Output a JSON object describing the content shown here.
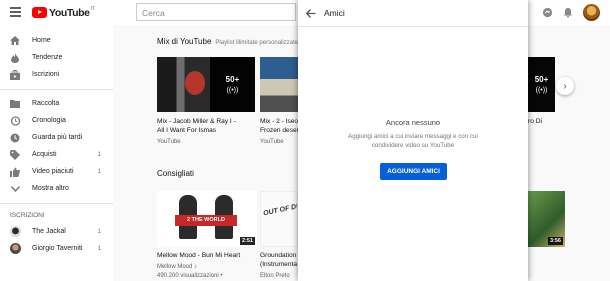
{
  "header": {
    "logo_text": "YouTube",
    "logo_country": "IT",
    "search_placeholder": "Cerca"
  },
  "sidebar": {
    "items": [
      {
        "label": "Home",
        "icon": "home-icon"
      },
      {
        "label": "Tendenze",
        "icon": "fire-icon"
      },
      {
        "label": "Iscrizioni",
        "icon": "subscriptions-icon"
      },
      {
        "label": "Raccolta",
        "icon": "folder-icon"
      },
      {
        "label": "Cronologia",
        "icon": "history-icon"
      },
      {
        "label": "Guarda più tardi",
        "icon": "clock-icon"
      },
      {
        "label": "Acquisti",
        "icon": "tag-icon",
        "count": "1"
      },
      {
        "label": "Video piaciuti",
        "icon": "thumb-up-icon",
        "count": "1"
      },
      {
        "label": "Mostra altro",
        "icon": "chevron-down-icon"
      }
    ],
    "subscriptions_heading": "ISCRIZIONI",
    "subscriptions": [
      {
        "label": "The Jackal",
        "count": "1"
      },
      {
        "label": "Giorgio Taverniti",
        "count": "1"
      }
    ]
  },
  "mixes": {
    "title": "Mix di YouTube",
    "subtitle": "Playlist illimitate personalizzate",
    "items": [
      {
        "title_line1": "Mix - Jacob Miller & Ray I -",
        "title_line2": "All I Want For Ismas",
        "channel": "YouTube",
        "count": "50+",
        "icon": "radio-icon"
      },
      {
        "title_line1": "Mix - 2 - Iseo",
        "title_line2": "Frozen deser",
        "channel": "YouTube",
        "count": "50+",
        "icon": "radio-icon"
      },
      {
        "title_line1": "ro Di",
        "title_line2": "",
        "channel": "",
        "count": "50+",
        "icon": "radio-icon"
      }
    ]
  },
  "recommended": {
    "title": "Consigliati",
    "items": [
      {
        "title": "Mellow Mood - Bun Mi Heart",
        "channel": "Mellow Mood ♪",
        "views": "490.200 visualizzazioni •",
        "duration": "2:51",
        "thumb_text": "2 THE WORLD"
      },
      {
        "title": "Groundation",
        "title_line2": "(Instrumenta",
        "channel": "Elton Preto",
        "thumb_text": "OUT OF DUB"
      },
      {
        "duration": "3:56"
      }
    ]
  },
  "friends_panel": {
    "title": "Amici",
    "empty_title": "Ancora nessuno",
    "description": "Aggiungi amici a cui inviare messaggi e con cui condividere video su YouTube",
    "button_label": "AGGIUNGI AMICI"
  },
  "colors": {
    "brand_red": "#ff0000",
    "button_blue": "#065fd4"
  }
}
